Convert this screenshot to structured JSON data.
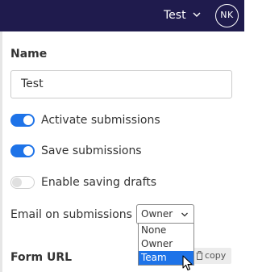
{
  "header": {
    "title": "Test",
    "avatar_initials": "NK",
    "background_color": "#1f1b4d"
  },
  "form": {
    "name_label": "Name",
    "name_value": "Test",
    "toggles": [
      {
        "label": "Activate submissions",
        "on": true
      },
      {
        "label": "Save submissions",
        "on": true
      },
      {
        "label": "Enable saving drafts",
        "on": false
      }
    ],
    "email_label": "Email on submissions",
    "email_select_value": "Owner",
    "email_options": [
      "None",
      "Owner",
      "Team"
    ],
    "email_highlighted_option": "Team",
    "form_url_label": "Form URL",
    "copy_label": "copy"
  },
  "colors": {
    "accent": "#1e73e8"
  }
}
